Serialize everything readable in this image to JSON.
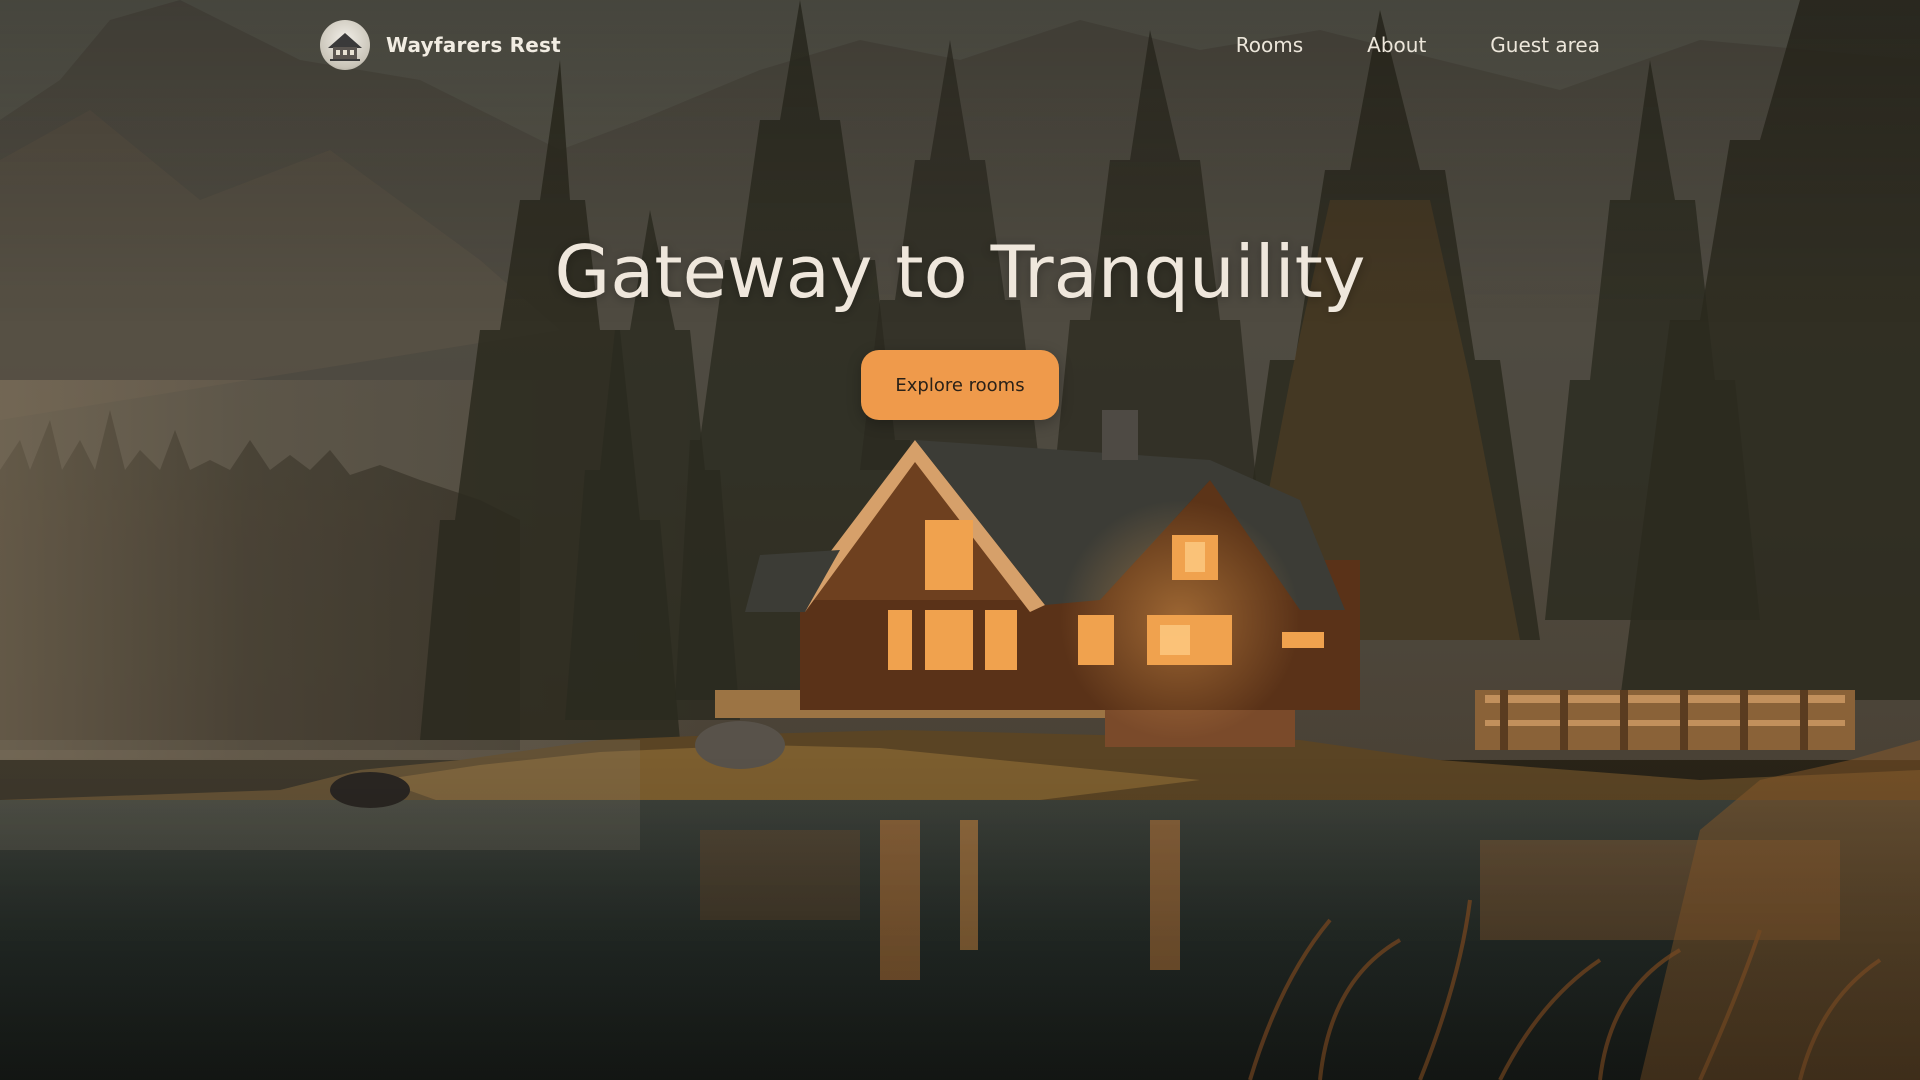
{
  "brand": {
    "name": "Wayfarers Rest",
    "logo_icon": "cabin-logo-icon"
  },
  "nav": {
    "items": [
      {
        "label": "Rooms"
      },
      {
        "label": "About"
      },
      {
        "label": "Guest area"
      }
    ]
  },
  "hero": {
    "headline": "Gateway to Tranquility",
    "cta_label": "Explore rooms",
    "background": "forest-lake-cabin-photo"
  },
  "colors": {
    "cta_background": "#ef9a4b",
    "cta_text": "#2a2118",
    "headline": "#efe7dc",
    "nav_text": "#ece6da"
  }
}
